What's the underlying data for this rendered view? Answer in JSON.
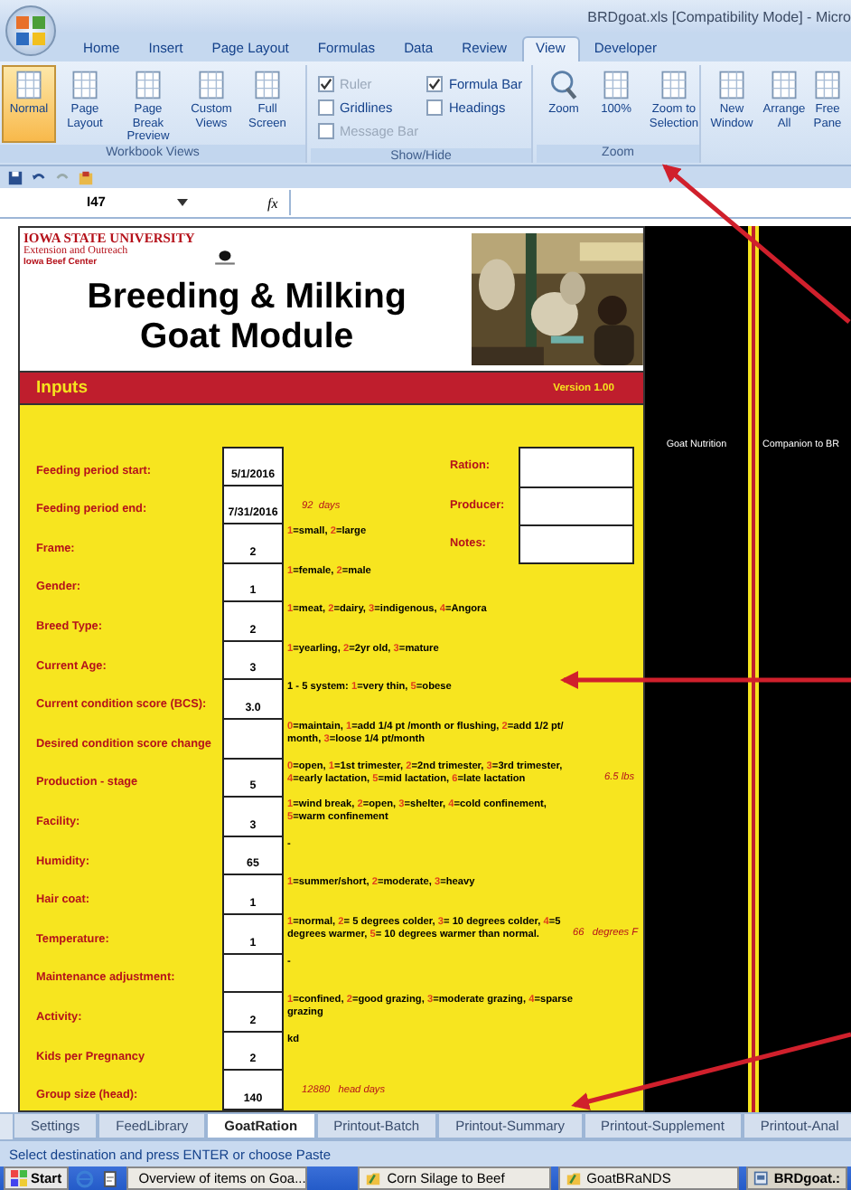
{
  "window": {
    "title": "BRDgoat.xls  [Compatibility Mode] - Micro"
  },
  "ribbon_tabs": [
    {
      "label": "Home",
      "selected": false
    },
    {
      "label": "Insert",
      "selected": false
    },
    {
      "label": "Page Layout",
      "selected": false
    },
    {
      "label": "Formulas",
      "selected": false
    },
    {
      "label": "Data",
      "selected": false
    },
    {
      "label": "Review",
      "selected": false
    },
    {
      "label": "View",
      "selected": true
    },
    {
      "label": "Developer",
      "selected": false
    }
  ],
  "ribbon_groups": [
    {
      "label": "Workbook Views",
      "kind": "buttons",
      "items": [
        {
          "label": "Normal",
          "selected": true
        },
        {
          "label": "Page Layout",
          "selected": false
        },
        {
          "label": "Page Break Preview",
          "selected": false
        },
        {
          "label": "Custom Views",
          "selected": false
        },
        {
          "label": "Full Screen",
          "selected": false
        }
      ]
    },
    {
      "label": "Show/Hide",
      "kind": "checks",
      "items": [
        {
          "label": "Ruler",
          "checked": true,
          "disabled": true
        },
        {
          "label": "Gridlines",
          "checked": false,
          "disabled": false
        },
        {
          "label": "Message Bar",
          "checked": false,
          "disabled": true
        },
        {
          "label": "Formula Bar",
          "checked": true,
          "disabled": false
        },
        {
          "label": "Headings",
          "checked": false,
          "disabled": false
        }
      ]
    },
    {
      "label": "Zoom",
      "kind": "buttons",
      "items": [
        {
          "label": "Zoom",
          "selected": false
        },
        {
          "label": "100%",
          "selected": false
        },
        {
          "label": "Zoom to Selection",
          "selected": false
        }
      ]
    },
    {
      "kind": "buttons",
      "items": [
        {
          "label": "New Window",
          "selected": false
        },
        {
          "label": "Arrange All",
          "selected": false
        },
        {
          "label": "Free Pane",
          "selected": false
        }
      ]
    }
  ],
  "formula_bar": {
    "name_box": "I47",
    "fx": "fx"
  },
  "header": {
    "university": "IOWA STATE UNIVERSITY",
    "unit": "Extension and Outreach",
    "center": "Iowa Beef Center",
    "title": "Breeding & Milking Goat Module"
  },
  "band": {
    "title": "Inputs",
    "version": "Version 1.00"
  },
  "side_panels": [
    "Goat Nutrition",
    "Companion to BR"
  ],
  "rows": [
    {
      "label": "Feeding period start:",
      "value": "5/1/2016",
      "side": {
        "label": "Ration:"
      }
    },
    {
      "label": "Feeding period end:",
      "value": "7/31/2016",
      "note": "92  days",
      "side": {
        "label": "Producer:"
      }
    },
    {
      "label": "Frame:",
      "value": "2",
      "desc": [
        {
          "n": "1",
          "t": "=small, "
        },
        {
          "n": "2",
          "t": "=large"
        }
      ],
      "side": {
        "label": "Notes:"
      }
    },
    {
      "label": "Gender:",
      "value": "1",
      "desc": [
        {
          "n": "1",
          "t": "=female, "
        },
        {
          "n": "2",
          "t": "=male"
        }
      ]
    },
    {
      "label": "Breed Type:",
      "value": "2",
      "desc": [
        {
          "n": "1",
          "t": "=meat, "
        },
        {
          "n": "2",
          "t": "=dairy, "
        },
        {
          "n": "3",
          "t": "=indigenous, "
        },
        {
          "n": "4",
          "t": "=Angora"
        }
      ]
    },
    {
      "label": "Current Age:",
      "value": "3",
      "desc": [
        {
          "n": "1",
          "t": "=yearling, "
        },
        {
          "n": "2",
          "t": "=2yr old, "
        },
        {
          "n": "3",
          "t": "=mature"
        }
      ]
    },
    {
      "label": "Current condition score (BCS):",
      "value": "3.0",
      "desc": [
        {
          "t": "1 - 5 system: "
        },
        {
          "n": "1",
          "t": "=very thin, "
        },
        {
          "n": "5",
          "t": "=obese"
        }
      ]
    },
    {
      "label": "Desired condition score change",
      "desc": [
        {
          "n": "0",
          "t": "=maintain, "
        },
        {
          "n": "1",
          "t": "=add 1/4 pt /month or flushing, "
        },
        {
          "n": "2",
          "t": "=add 1/2 pt/ month, "
        },
        {
          "n": "3",
          "t": "=loose 1/4 pt/month"
        }
      ]
    },
    {
      "label": "Production - stage",
      "value": "5",
      "note": "6.5 lbs",
      "desc": [
        {
          "n": "0",
          "t": "=open, "
        },
        {
          "n": "1",
          "t": "=1st trimester, "
        },
        {
          "n": "2",
          "t": "=2nd trimester, "
        },
        {
          "n": "3",
          "t": "=3rd trimester, "
        },
        {
          "n": "4",
          "t": "=early lactation, "
        },
        {
          "n": "5",
          "t": "=mid lactation, "
        },
        {
          "n": "6",
          "t": "=late lactation"
        }
      ]
    },
    {
      "label": "Facility:",
      "value": "3",
      "desc": [
        {
          "n": "1",
          "t": "=wind break, "
        },
        {
          "n": "2",
          "t": "=open, "
        },
        {
          "n": "3",
          "t": "=shelter, "
        },
        {
          "n": "4",
          "t": "=cold confinement, "
        },
        {
          "n": "5",
          "t": "=warm confinement"
        }
      ]
    },
    {
      "label": "Humidity:",
      "value": "65",
      "desc": [
        {
          "t": "-"
        }
      ]
    },
    {
      "label": "Hair coat:",
      "value": "1",
      "desc": [
        {
          "n": "1",
          "t": "=summer/short, "
        },
        {
          "n": "2",
          "t": "=moderate, "
        },
        {
          "n": "3",
          "t": "=heavy"
        }
      ]
    },
    {
      "label": "Temperature:",
      "value": "1",
      "note": "66   degrees F",
      "desc": [
        {
          "n": "1",
          "t": "=normal, "
        },
        {
          "n": "2",
          "t": "= 5 degrees colder, "
        },
        {
          "n": "3",
          "t": "= 10 degrees colder, "
        },
        {
          "n": "4",
          "t": "=5 degrees warmer, "
        },
        {
          "n": "5",
          "t": "= 10 degrees warmer than normal."
        }
      ]
    },
    {
      "label": "Maintenance adjustment:",
      "desc": [
        {
          "t": "-"
        }
      ]
    },
    {
      "label": "Activity:",
      "value": "2",
      "desc": [
        {
          "n": "1",
          "t": "=confined, "
        },
        {
          "n": "2",
          "t": "=good grazing, "
        },
        {
          "n": "3",
          "t": "=moderate grazing, "
        },
        {
          "n": "4",
          "t": "=sparse grazing"
        }
      ]
    },
    {
      "label": "Kids per Pregnancy",
      "value": "2",
      "desc": [
        {
          "t": "kd"
        }
      ]
    },
    {
      "label": "Group size  (head):",
      "value": "140",
      "note": "12880   head days"
    }
  ],
  "sheet_tabs": [
    {
      "label": "Settings",
      "selected": false
    },
    {
      "label": "FeedLibrary",
      "selected": false
    },
    {
      "label": "GoatRation",
      "selected": true
    },
    {
      "label": "Printout-Batch",
      "selected": false
    },
    {
      "label": "Printout-Summary",
      "selected": false
    },
    {
      "label": "Printout-Supplement",
      "selected": false
    },
    {
      "label": "Printout-Anal",
      "selected": false
    }
  ],
  "status_bar": "Select destination and press ENTER or choose Paste",
  "taskbar": {
    "start": "Start",
    "windows": [
      {
        "label": "Overview of items on Goa...",
        "kind": "doc",
        "selected": false
      },
      {
        "label": "Corn Silage to Beef",
        "kind": "folder",
        "selected": false
      },
      {
        "label": "GoatBRaNDS",
        "kind": "folder",
        "selected": false
      },
      {
        "label": "BRDgoat.:",
        "kind": "doc",
        "selected": true
      }
    ]
  }
}
